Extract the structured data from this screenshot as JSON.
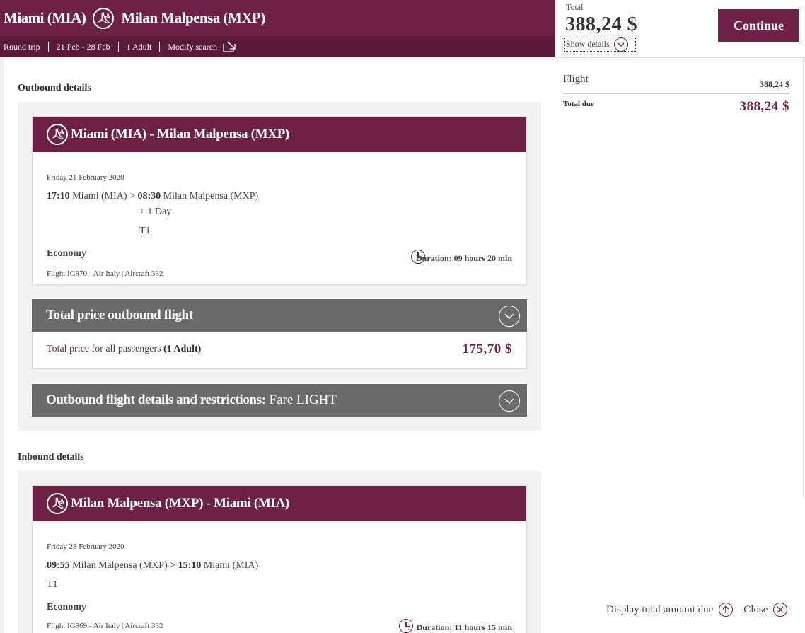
{
  "header": {
    "origin": "Miami (MIA)",
    "destination": "Milan Malpensa (MXP)",
    "trip_type": "Round trip",
    "dates": "21 Feb - 28 Feb",
    "passengers": "1 Adult",
    "modify": "Modify search"
  },
  "summary": {
    "total_label": "Total",
    "total_value": "388,24 $",
    "show_details": "Show details",
    "continue_label": "Continue",
    "flight_label": "Flight",
    "flight_value": "388,24 $",
    "total_due_label": "Total due",
    "total_due_value": "388,24 $"
  },
  "outbound": {
    "section_title": "Outbound details",
    "card_title": "Miami (MIA) - Milan Malpensa (MXP)",
    "date": "Friday 21 February 2020",
    "dep_time": "17:10",
    "dep_airport": "Miami (MIA)",
    "arrow": ">",
    "arr_time": "08:30",
    "arr_airport": "Milan Malpensa (MXP)",
    "day_offset": "+ 1 Day",
    "terminal": "T1",
    "cabin": "Economy",
    "flight_info": "Flight IG970 - Air Italy | Aircraft 332",
    "duration": "Duration: 09 hours 20 min",
    "price_bar_title": "Total price outbound flight",
    "price_label_link": "Total price",
    "price_label_rest": " for all passengers ",
    "price_pax": "(1 Adult)",
    "price_value": "175,70 $",
    "restrictions_title": "Outbound flight details and restrictions:",
    "fare": "Fare LIGHT"
  },
  "inbound": {
    "section_title": "Inbound details",
    "card_title": "Milan Malpensa (MXP) - Miami (MIA)",
    "date": "Friday 28 February 2020",
    "dep_time": "09:55",
    "dep_airport": "Milan Malpensa (MXP)",
    "arrow": ">",
    "arr_time": "15:10",
    "arr_airport": "Miami (MIA)",
    "terminal": "T1",
    "cabin": "Economy",
    "flight_info": "Flight IG969 - Air Italy | Aircraft 332",
    "duration": "Duration: 11 hours 15 min"
  },
  "footer": {
    "display_total": "Display total amount due",
    "close": "Close"
  },
  "colors": {
    "brand": "#6d2146",
    "grey_bar": "#6b6b6b",
    "section_bg": "#f2f2f2"
  },
  "icons": [
    "plane-icon",
    "external-link-icon",
    "chevron-down-icon",
    "clock-icon",
    "arrow-up-icon",
    "close-icon"
  ]
}
